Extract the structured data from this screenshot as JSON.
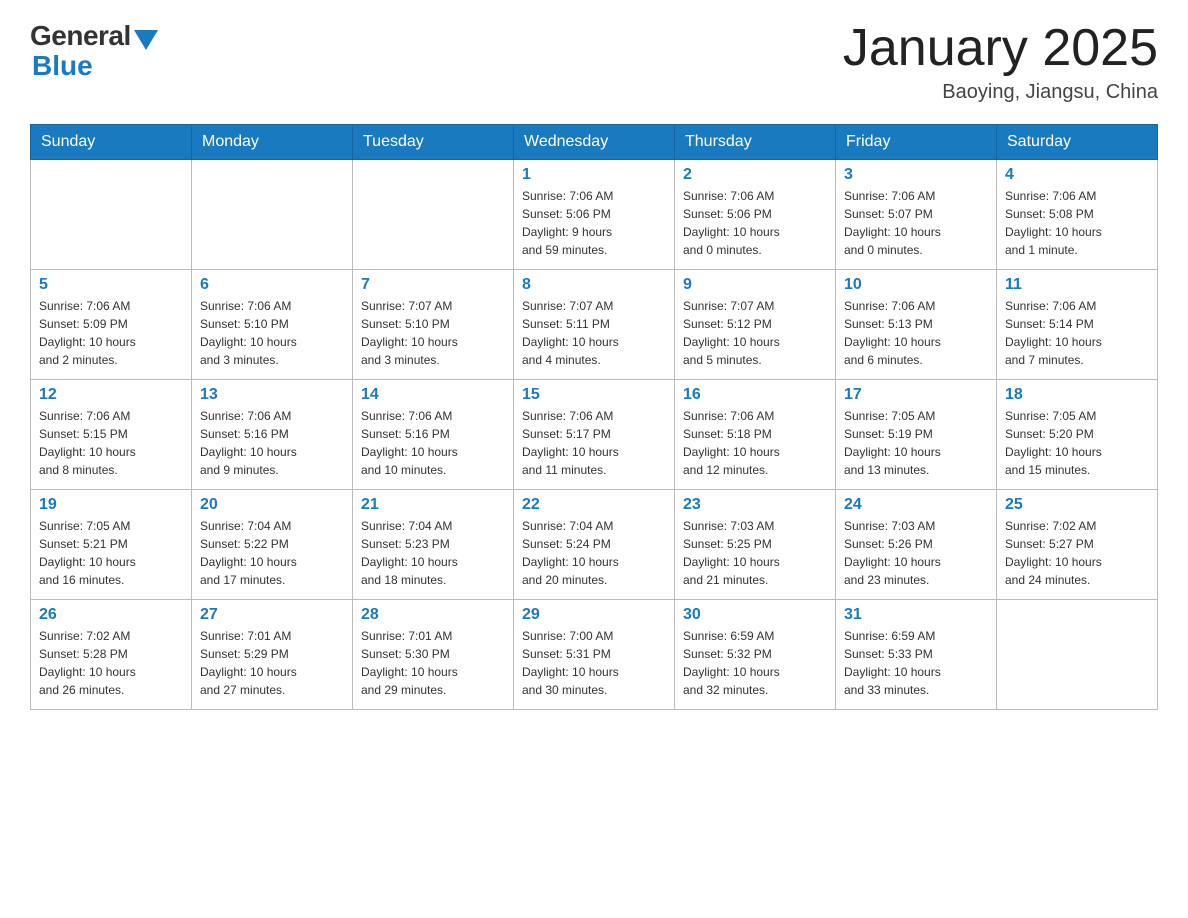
{
  "header": {
    "logo_general": "General",
    "logo_blue": "Blue",
    "month_title": "January 2025",
    "location": "Baoying, Jiangsu, China"
  },
  "days_of_week": [
    "Sunday",
    "Monday",
    "Tuesday",
    "Wednesday",
    "Thursday",
    "Friday",
    "Saturday"
  ],
  "weeks": [
    [
      {
        "day": "",
        "info": ""
      },
      {
        "day": "",
        "info": ""
      },
      {
        "day": "",
        "info": ""
      },
      {
        "day": "1",
        "info": "Sunrise: 7:06 AM\nSunset: 5:06 PM\nDaylight: 9 hours\nand 59 minutes."
      },
      {
        "day": "2",
        "info": "Sunrise: 7:06 AM\nSunset: 5:06 PM\nDaylight: 10 hours\nand 0 minutes."
      },
      {
        "day": "3",
        "info": "Sunrise: 7:06 AM\nSunset: 5:07 PM\nDaylight: 10 hours\nand 0 minutes."
      },
      {
        "day": "4",
        "info": "Sunrise: 7:06 AM\nSunset: 5:08 PM\nDaylight: 10 hours\nand 1 minute."
      }
    ],
    [
      {
        "day": "5",
        "info": "Sunrise: 7:06 AM\nSunset: 5:09 PM\nDaylight: 10 hours\nand 2 minutes."
      },
      {
        "day": "6",
        "info": "Sunrise: 7:06 AM\nSunset: 5:10 PM\nDaylight: 10 hours\nand 3 minutes."
      },
      {
        "day": "7",
        "info": "Sunrise: 7:07 AM\nSunset: 5:10 PM\nDaylight: 10 hours\nand 3 minutes."
      },
      {
        "day": "8",
        "info": "Sunrise: 7:07 AM\nSunset: 5:11 PM\nDaylight: 10 hours\nand 4 minutes."
      },
      {
        "day": "9",
        "info": "Sunrise: 7:07 AM\nSunset: 5:12 PM\nDaylight: 10 hours\nand 5 minutes."
      },
      {
        "day": "10",
        "info": "Sunrise: 7:06 AM\nSunset: 5:13 PM\nDaylight: 10 hours\nand 6 minutes."
      },
      {
        "day": "11",
        "info": "Sunrise: 7:06 AM\nSunset: 5:14 PM\nDaylight: 10 hours\nand 7 minutes."
      }
    ],
    [
      {
        "day": "12",
        "info": "Sunrise: 7:06 AM\nSunset: 5:15 PM\nDaylight: 10 hours\nand 8 minutes."
      },
      {
        "day": "13",
        "info": "Sunrise: 7:06 AM\nSunset: 5:16 PM\nDaylight: 10 hours\nand 9 minutes."
      },
      {
        "day": "14",
        "info": "Sunrise: 7:06 AM\nSunset: 5:16 PM\nDaylight: 10 hours\nand 10 minutes."
      },
      {
        "day": "15",
        "info": "Sunrise: 7:06 AM\nSunset: 5:17 PM\nDaylight: 10 hours\nand 11 minutes."
      },
      {
        "day": "16",
        "info": "Sunrise: 7:06 AM\nSunset: 5:18 PM\nDaylight: 10 hours\nand 12 minutes."
      },
      {
        "day": "17",
        "info": "Sunrise: 7:05 AM\nSunset: 5:19 PM\nDaylight: 10 hours\nand 13 minutes."
      },
      {
        "day": "18",
        "info": "Sunrise: 7:05 AM\nSunset: 5:20 PM\nDaylight: 10 hours\nand 15 minutes."
      }
    ],
    [
      {
        "day": "19",
        "info": "Sunrise: 7:05 AM\nSunset: 5:21 PM\nDaylight: 10 hours\nand 16 minutes."
      },
      {
        "day": "20",
        "info": "Sunrise: 7:04 AM\nSunset: 5:22 PM\nDaylight: 10 hours\nand 17 minutes."
      },
      {
        "day": "21",
        "info": "Sunrise: 7:04 AM\nSunset: 5:23 PM\nDaylight: 10 hours\nand 18 minutes."
      },
      {
        "day": "22",
        "info": "Sunrise: 7:04 AM\nSunset: 5:24 PM\nDaylight: 10 hours\nand 20 minutes."
      },
      {
        "day": "23",
        "info": "Sunrise: 7:03 AM\nSunset: 5:25 PM\nDaylight: 10 hours\nand 21 minutes."
      },
      {
        "day": "24",
        "info": "Sunrise: 7:03 AM\nSunset: 5:26 PM\nDaylight: 10 hours\nand 23 minutes."
      },
      {
        "day": "25",
        "info": "Sunrise: 7:02 AM\nSunset: 5:27 PM\nDaylight: 10 hours\nand 24 minutes."
      }
    ],
    [
      {
        "day": "26",
        "info": "Sunrise: 7:02 AM\nSunset: 5:28 PM\nDaylight: 10 hours\nand 26 minutes."
      },
      {
        "day": "27",
        "info": "Sunrise: 7:01 AM\nSunset: 5:29 PM\nDaylight: 10 hours\nand 27 minutes."
      },
      {
        "day": "28",
        "info": "Sunrise: 7:01 AM\nSunset: 5:30 PM\nDaylight: 10 hours\nand 29 minutes."
      },
      {
        "day": "29",
        "info": "Sunrise: 7:00 AM\nSunset: 5:31 PM\nDaylight: 10 hours\nand 30 minutes."
      },
      {
        "day": "30",
        "info": "Sunrise: 6:59 AM\nSunset: 5:32 PM\nDaylight: 10 hours\nand 32 minutes."
      },
      {
        "day": "31",
        "info": "Sunrise: 6:59 AM\nSunset: 5:33 PM\nDaylight: 10 hours\nand 33 minutes."
      },
      {
        "day": "",
        "info": ""
      }
    ]
  ]
}
